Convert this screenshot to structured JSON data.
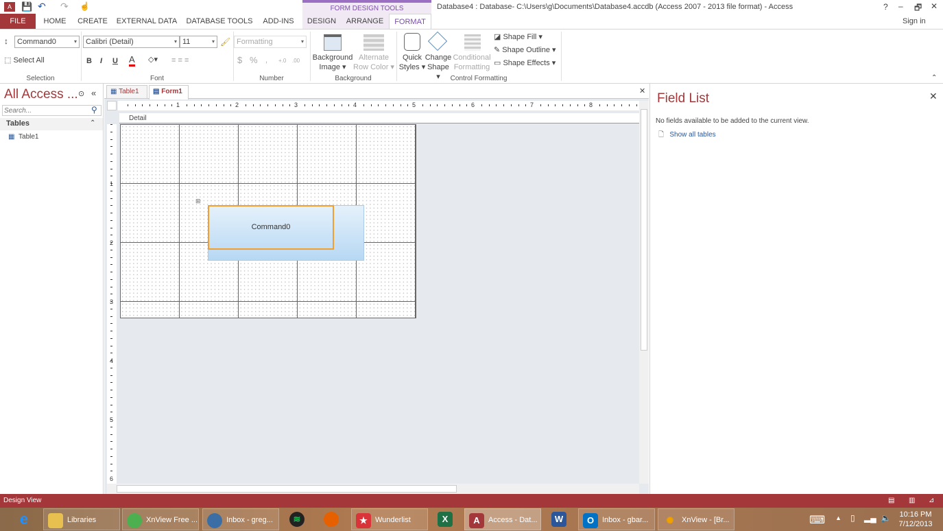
{
  "window": {
    "title": "Database4 : Database- C:\\Users\\g\\Documents\\Database4.accdb (Access 2007 - 2013 file format) - Access",
    "help": "?",
    "minimize": "–",
    "restore": "🗗",
    "close": "✕",
    "sign_in": "Sign in"
  },
  "contextual_tab_group": "FORM DESIGN TOOLS",
  "tabs": [
    "FILE",
    "HOME",
    "CREATE",
    "EXTERNAL DATA",
    "DATABASE TOOLS",
    "ADD-INS",
    "DESIGN",
    "ARRANGE",
    "FORMAT"
  ],
  "active_tab": "FORMAT",
  "ribbon": {
    "selection": {
      "object": "Command0",
      "select_all": "Select All",
      "label": "Selection"
    },
    "font": {
      "name": "Calibri (Detail)",
      "size": "11",
      "bold": "B",
      "italic": "I",
      "underline": "U",
      "font_color": "A",
      "label": "Font",
      "font_color_hex": "#e00000"
    },
    "number": {
      "format": "Formatting",
      "currency": "$",
      "percent": "%",
      "comma": ",",
      "inc": "+.0",
      "dec": ".00",
      "label": "Number"
    },
    "background": {
      "bg_image": [
        "Background",
        "Image ▾"
      ],
      "alt_row": [
        "Alternate",
        "Row Color ▾"
      ],
      "label": "Background"
    },
    "control_formatting": {
      "quick_styles": [
        "Quick",
        "Styles ▾"
      ],
      "change_shape": [
        "Change",
        "Shape ▾"
      ],
      "conditional": [
        "Conditional",
        "Formatting"
      ],
      "shape_fill": "Shape Fill ▾",
      "shape_outline": "Shape Outline ▾",
      "shape_effects": "Shape Effects ▾",
      "label": "Control Formatting"
    }
  },
  "nav": {
    "title": "All Access ...",
    "search_placeholder": "Search...",
    "section": "Tables",
    "items": [
      "Table1"
    ]
  },
  "doc_tabs": [
    "Table1",
    "Form1"
  ],
  "active_doc": "Form1",
  "ruler": [
    "1",
    "2",
    "3",
    "4",
    "5",
    "6",
    "7",
    "8"
  ],
  "vruler": [
    "1",
    "2",
    "3",
    "4",
    "5",
    "6"
  ],
  "form": {
    "section": "Detail",
    "button": "Command0"
  },
  "field_list": {
    "title": "Field List",
    "message": "No fields available to be added to the current view.",
    "link": "Show all tables"
  },
  "status": "Design View",
  "taskbar": {
    "items": [
      "Libraries",
      "XnView Free ...",
      "Inbox - greg...",
      "Wunderlist",
      "Access - Dat...",
      "Inbox - gbar...",
      "XnView - [Br..."
    ],
    "time": "10:16 PM",
    "date": "7/12/2013"
  }
}
